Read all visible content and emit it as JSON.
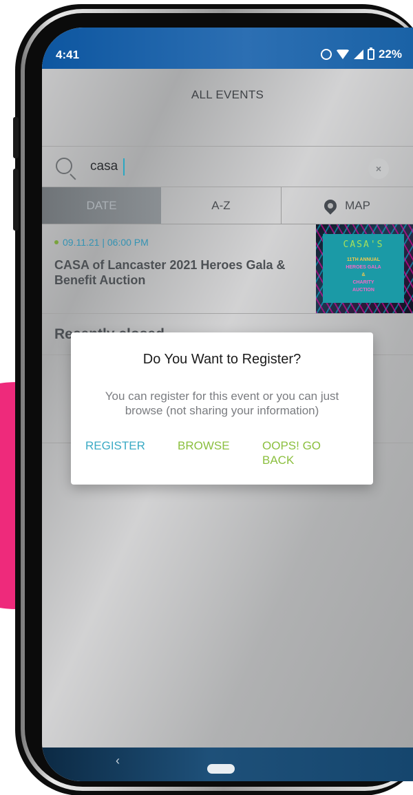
{
  "status_bar": {
    "time": "4:41",
    "battery": "22%",
    "icons": [
      "alarm-icon",
      "wifi-icon",
      "signal-icon",
      "battery-icon"
    ]
  },
  "header": {
    "title": "ALL EVENTS"
  },
  "search": {
    "value": "casa",
    "clear_icon": "×"
  },
  "tabs": [
    {
      "label": "DATE",
      "active": true
    },
    {
      "label": "A-Z",
      "active": false
    },
    {
      "label": "MAP",
      "active": false,
      "icon": "map-pin-icon"
    }
  ],
  "event": {
    "date": "09.11.21 | 06:00 PM",
    "title": "CASA of Lancaster 2021 Heroes Gala & Benefit Auction",
    "thumbnail": {
      "logo": "CASA'S",
      "lines": [
        "11TH ANNUAL",
        "HEROES GALA",
        "&",
        "CHARITY",
        "AUCTION"
      ]
    }
  },
  "section": {
    "title": "Recently closed"
  },
  "dialog": {
    "title": "Do You Want to Register?",
    "message": "You can register for this event or you can just browse (not sharing your information)",
    "register_label": "REGISTER",
    "browse_label": "BROWSE",
    "back_label": "OOPS! GO BACK"
  },
  "nav": {
    "back_glyph": "‹"
  },
  "colors": {
    "accent_blue": "#3aaac4",
    "accent_green": "#8bbf3e",
    "pink": "#ee2a7b"
  }
}
